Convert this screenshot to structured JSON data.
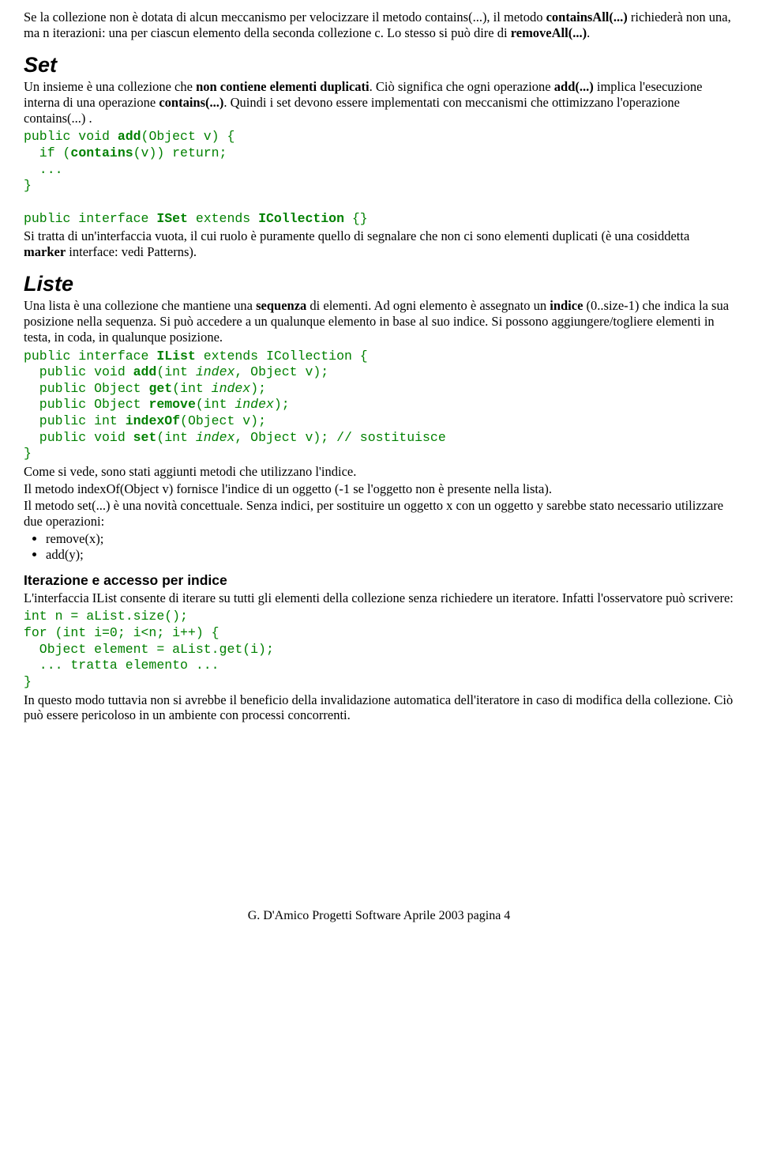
{
  "p1_a": "Se la collezione non è dotata di alcun meccanismo per velocizzare il metodo contains(...), il metodo ",
  "p1_b": "containsAll(...)",
  "p1_c": " richiederà non una, ma n iterazioni: una per ciascun elemento della seconda collezione c. Lo stesso si può dire di ",
  "p1_d": "removeAll(...)",
  "p1_e": ".",
  "set_heading": "Set",
  "set_p1_a": "Un insieme è una collezione che ",
  "set_p1_b": "non contiene elementi duplicati",
  "set_p1_c": ". Ciò significa che ogni operazione ",
  "set_p1_d": "add(...)",
  "set_p1_e": " implica l'esecuzione interna di una operazione ",
  "set_p1_f": "contains(...)",
  "set_p1_g": ". Quindi i set devono essere implementati con meccanismi che ottimizzano l'operazione contains(...) .",
  "code1_l1a": "public void ",
  "code1_l1b": "add",
  "code1_l1c": "(Object v) {",
  "code1_l2a": "  if (",
  "code1_l2b": "contains",
  "code1_l2c": "(v)) return;",
  "code1_l3": "  ...",
  "code1_l4": "}",
  "code1_blank": "",
  "code1_l5a": "public interface ",
  "code1_l5b": "ISet",
  "code1_l5c": " extends ",
  "code1_l5d": "ICollection",
  "code1_l5e": " {}",
  "set_p2_a": "Si tratta di un'interfaccia vuota, il cui ruolo è puramente quello di segnalare che non ci sono elementi duplicati (è una cosiddetta ",
  "set_p2_b": "marker",
  "set_p2_c": " interface: vedi Patterns).",
  "liste_heading": "Liste",
  "liste_p1_a": "Una lista è una collezione che mantiene una ",
  "liste_p1_b": "sequenza",
  "liste_p1_c": " di elementi. Ad ogni elemento è assegnato un ",
  "liste_p1_d": "indice",
  "liste_p1_e": " (0..size-1) che indica la sua posizione nella sequenza. Si può accedere a un qualunque elemento in base al suo indice. Si possono aggiungere/togliere elementi in testa, in coda, in qualunque posizione.",
  "code2_l1a": "public interface ",
  "code2_l1b": "IList",
  "code2_l1c": " extends ICollection {",
  "code2_l2a": "  public void ",
  "code2_l2b": "add",
  "code2_l2c": "(int ",
  "code2_l2d": "index",
  "code2_l2e": ", Object v);",
  "code2_l3a": "  public Object ",
  "code2_l3b": "get",
  "code2_l3c": "(int ",
  "code2_l3d": "index",
  "code2_l3e": ");",
  "code2_l4a": "  public Object ",
  "code2_l4b": "remove",
  "code2_l4c": "(int ",
  "code2_l4d": "index",
  "code2_l4e": ");",
  "code2_l5a": "  public int ",
  "code2_l5b": "indexOf",
  "code2_l5c": "(Object v);",
  "code2_l6a": "  public void ",
  "code2_l6b": "set",
  "code2_l6c": "(int ",
  "code2_l6d": "index",
  "code2_l6e": ", Object v); // sostituisce",
  "code2_l7": "}",
  "liste_p2": "Come si vede, sono stati aggiunti metodi che utilizzano l'indice.",
  "liste_p3": "Il metodo indexOf(Object v) fornisce l'indice di un oggetto (-1 se l'oggetto non è presente nella lista).",
  "liste_p4": "Il metodo set(...) è una novità concettuale. Senza indici, per sostituire un oggetto x con un oggetto y sarebbe stato necessario utilizzare due operazioni:",
  "liste_li1": "remove(x);",
  "liste_li2": "add(y);",
  "iter_heading": "Iterazione e accesso per indice",
  "iter_p1": "L'interfaccia IList consente di iterare su tutti gli elementi della collezione senza richiedere un iteratore. Infatti l'osservatore può scrivere:",
  "code3_l1": "int n = aList.size();",
  "code3_l2": "for (int i=0; i<n; i++) {",
  "code3_l3": "  Object element = aList.get(i);",
  "code3_l4": "  ... tratta elemento ...",
  "code3_l5": "}",
  "iter_p2": "In questo modo tuttavia non si avrebbe il beneficio della invalidazione automatica dell'iteratore in caso di modifica della collezione. Ciò può essere pericoloso in un ambiente con processi concorrenti.",
  "footer": "G. D'Amico Progetti Software Aprile 2003 pagina 4"
}
